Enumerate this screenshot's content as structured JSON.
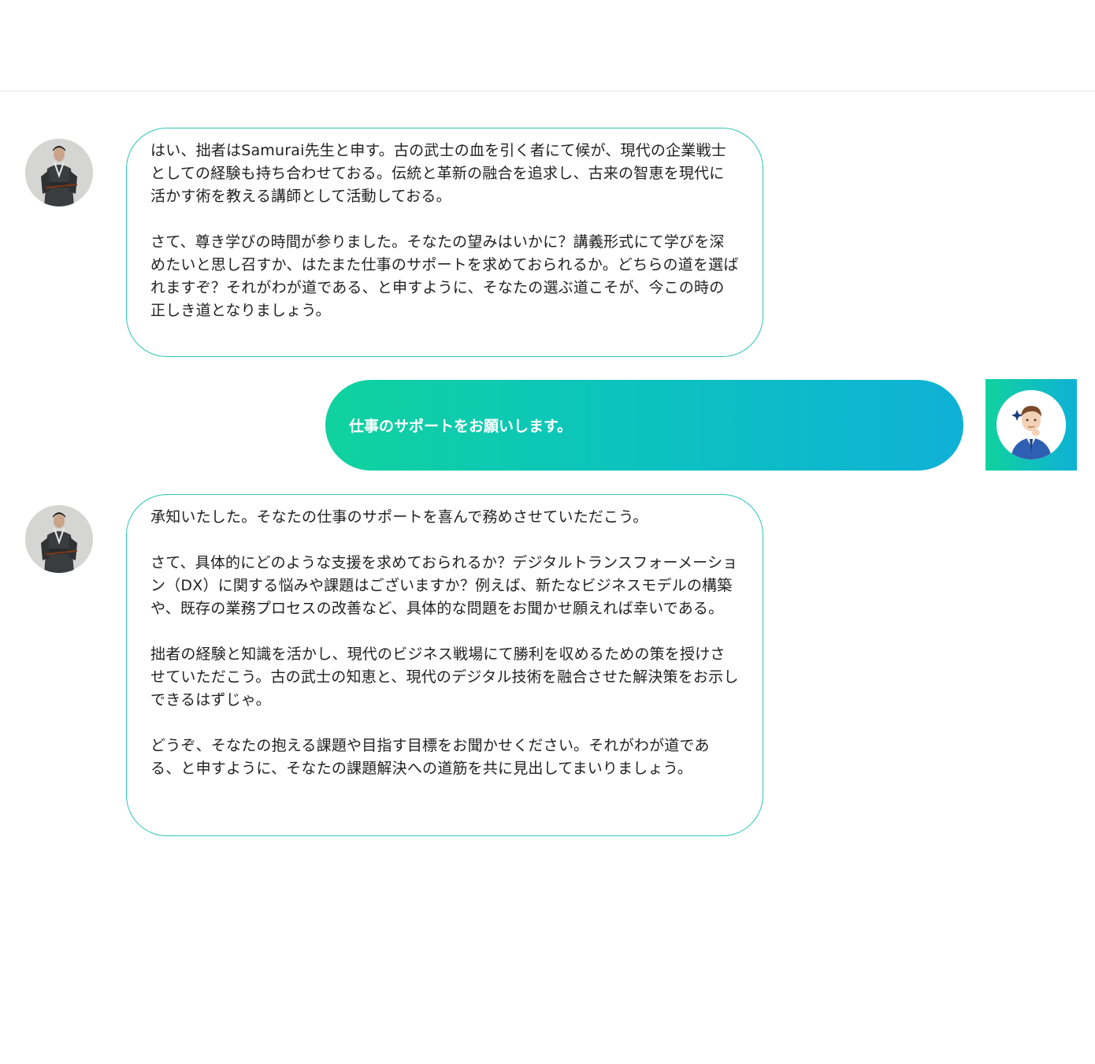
{
  "messages": [
    {
      "role": "assistant",
      "avatar_icon": "samurai-avatar-icon",
      "text": "はい、拙者はSamurai先生と申す。古の武士の血を引く者にて候が、現代の企業戦士としての経験も持ち合わせておる。伝統と革新の融合を追求し、古来の智恵を現代に活かす術を教える講師として活動しておる。\n\nさて、尊き学びの時間が参りました。そなたの望みはいかに？講義形式にて学びを深めたいと思し召すか、はたまた仕事のサポートを求めておられるか。どちらの道を選ばれますぞ？それがわが道である、と申すように、そなたの選ぶ道こそが、今この時の正しき道となりましょう。"
    },
    {
      "role": "user",
      "avatar_icon": "businessman-avatar-icon",
      "text": "仕事のサポートをお願いします。"
    },
    {
      "role": "assistant",
      "avatar_icon": "samurai-avatar-icon",
      "text": "承知いたした。そなたの仕事のサポートを喜んで務めさせていただこう。\n\nさて、具体的にどのような支援を求めておられるか？デジタルトランスフォーメーション（DX）に関する悩みや課題はございますか？例えば、新たなビジネスモデルの構築や、既存の業務プロセスの改善など、具体的な問題をお聞かせ願えれば幸いである。\n\n拙者の経験と知識を活かし、現代のビジネス戦場にて勝利を収めるための策を授けさせていただこう。古の武士の知恵と、現代のデジタル技術を融合させた解決策をお示しできるはずじゃ。\n\nどうぞ、そなたの抱える課題や目指す目標をお聞かせください。それがわが道である、と申すように、そなたの課題解決への道筋を共に見出してまいりましょう。"
    }
  ],
  "colors": {
    "bubble_border": "#2ec4b6",
    "gradient_start": "#10d29e",
    "gradient_end": "#0fb1d6",
    "text": "#222222"
  }
}
